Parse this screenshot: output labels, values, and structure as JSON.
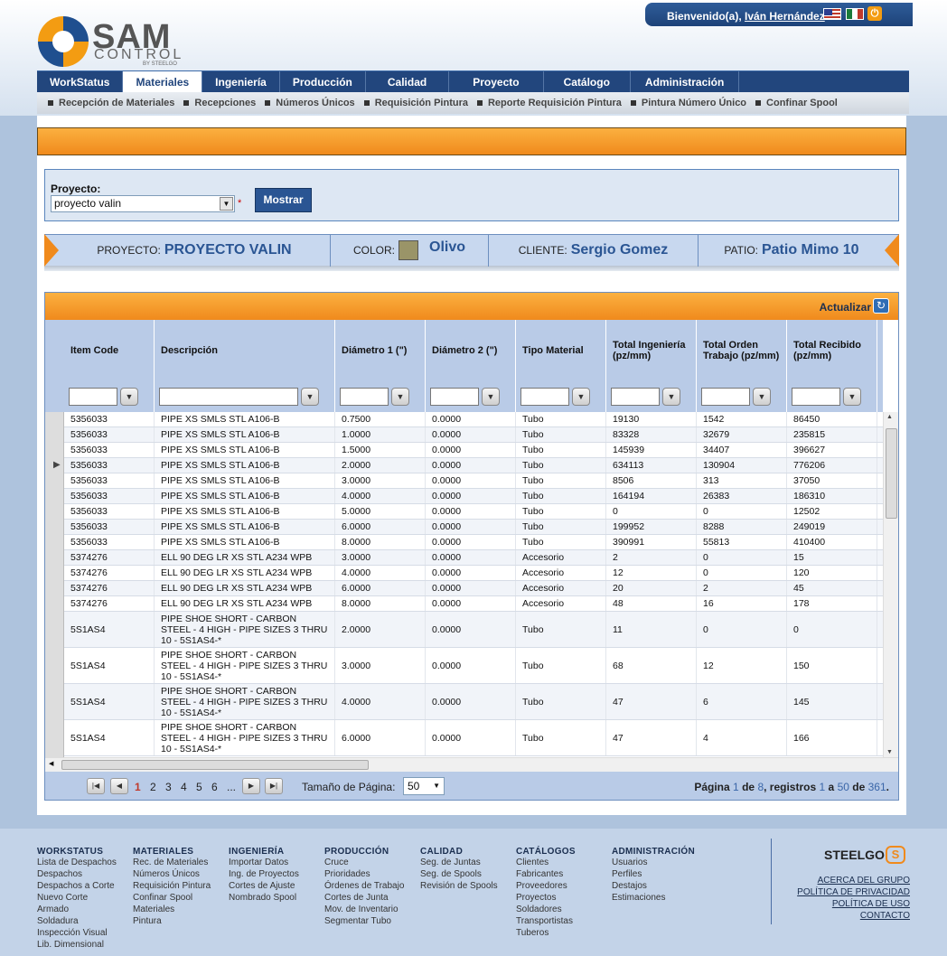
{
  "header": {
    "welcome_prefix": "Bienvenido(a),",
    "user_name": "Iván Hernández",
    "logo_main": "SAM",
    "logo_sub": "CONTROL",
    "logo_by": "BY STEELGO"
  },
  "main_nav": [
    "WorkStatus",
    "Materiales",
    "Ingeniería",
    "Producción",
    "Calidad",
    "Proyecto",
    "Catálogo",
    "Administración"
  ],
  "sub_nav": [
    "Recepción de Materiales",
    "Recepciones",
    "Números Únicos",
    "Requisición Pintura",
    "Reporte Requisición Pintura",
    "Pintura Número Único",
    "Confinar Spool"
  ],
  "filter": {
    "label": "Proyecto:",
    "project_value": "proyecto valin",
    "required_mark": "*",
    "show_button": "Mostrar"
  },
  "project_info": {
    "project_label": "PROYECTO:",
    "project_value": "PROYECTO VALIN",
    "color_label": "COLOR:",
    "color_value": "Olivo",
    "color_swatch": "#9a9468",
    "client_label": "CLIENTE:",
    "client_value": "Sergio Gomez",
    "yard_label": "PATIO:",
    "yard_value": "Patio Mimo 10"
  },
  "grid": {
    "refresh_label": "Actualizar",
    "columns": [
      "Item Code",
      "Descripción",
      "Diámetro 1 (\")",
      "Diámetro 2 (\")",
      "Tipo Material",
      "Total Ingeniería (pz/mm)",
      "Total Orden Trabajo (pz/mm)",
      "Total Recibido (pz/mm)"
    ],
    "rows": [
      [
        "5356033",
        "PIPE XS SMLS STL A106-B",
        "0.7500",
        "0.0000",
        "Tubo",
        "19130",
        "1542",
        "86450"
      ],
      [
        "5356033",
        "PIPE XS SMLS STL A106-B",
        "1.0000",
        "0.0000",
        "Tubo",
        "83328",
        "32679",
        "235815"
      ],
      [
        "5356033",
        "PIPE XS SMLS STL A106-B",
        "1.5000",
        "0.0000",
        "Tubo",
        "145939",
        "34407",
        "396627"
      ],
      [
        "5356033",
        "PIPE XS SMLS STL A106-B",
        "2.0000",
        "0.0000",
        "Tubo",
        "634113",
        "130904",
        "776206"
      ],
      [
        "5356033",
        "PIPE XS SMLS STL A106-B",
        "3.0000",
        "0.0000",
        "Tubo",
        "8506",
        "313",
        "37050"
      ],
      [
        "5356033",
        "PIPE XS SMLS STL A106-B",
        "4.0000",
        "0.0000",
        "Tubo",
        "164194",
        "26383",
        "186310"
      ],
      [
        "5356033",
        "PIPE XS SMLS STL A106-B",
        "5.0000",
        "0.0000",
        "Tubo",
        "0",
        "0",
        "12502"
      ],
      [
        "5356033",
        "PIPE XS SMLS STL A106-B",
        "6.0000",
        "0.0000",
        "Tubo",
        "199952",
        "8288",
        "249019"
      ],
      [
        "5356033",
        "PIPE XS SMLS STL A106-B",
        "8.0000",
        "0.0000",
        "Tubo",
        "390991",
        "55813",
        "410400"
      ],
      [
        "5374276",
        "ELL 90 DEG LR XS STL A234 WPB",
        "3.0000",
        "0.0000",
        "Accesorio",
        "2",
        "0",
        "15"
      ],
      [
        "5374276",
        "ELL 90 DEG LR XS STL A234 WPB",
        "4.0000",
        "0.0000",
        "Accesorio",
        "12",
        "0",
        "120"
      ],
      [
        "5374276",
        "ELL 90 DEG LR XS STL A234 WPB",
        "6.0000",
        "0.0000",
        "Accesorio",
        "20",
        "2",
        "45"
      ],
      [
        "5374276",
        "ELL 90 DEG LR XS STL A234 WPB",
        "8.0000",
        "0.0000",
        "Accesorio",
        "48",
        "16",
        "178"
      ],
      [
        "5S1AS4",
        "PIPE SHOE SHORT - CARBON STEEL - 4 HIGH - PIPE SIZES 3 THRU 10 - 5S1AS4-*",
        "2.0000",
        "0.0000",
        "Tubo",
        "11",
        "0",
        "0"
      ],
      [
        "5S1AS4",
        "PIPE SHOE SHORT - CARBON STEEL - 4 HIGH - PIPE SIZES 3 THRU 10 - 5S1AS4-*",
        "3.0000",
        "0.0000",
        "Tubo",
        "68",
        "12",
        "150"
      ],
      [
        "5S1AS4",
        "PIPE SHOE SHORT - CARBON STEEL - 4 HIGH - PIPE SIZES 3 THRU 10 - 5S1AS4-*",
        "4.0000",
        "0.0000",
        "Tubo",
        "47",
        "6",
        "145"
      ],
      [
        "5S1AS4",
        "PIPE SHOE SHORT - CARBON STEEL - 4 HIGH - PIPE SIZES 3 THRU 10 - 5S1AS4-*",
        "6.0000",
        "0.0000",
        "Tubo",
        "47",
        "4",
        "166"
      ]
    ]
  },
  "pager": {
    "pages": [
      "1",
      "2",
      "3",
      "4",
      "5",
      "6",
      "..."
    ],
    "current_page": "1",
    "page_size_label": "Tamaño de Página:",
    "page_size": "50",
    "info_pagina": "Página",
    "info_page": "1",
    "info_de": "de",
    "info_total_pages": "8",
    "info_registros": ", registros",
    "info_from": "1",
    "info_a": "a",
    "info_to": "50",
    "info_de2": "de",
    "info_total": "361",
    "info_end": "."
  },
  "footer": {
    "columns": [
      {
        "title": "WORKSTATUS",
        "links": [
          "Lista de Despachos",
          "Despachos",
          "Despachos a Corte",
          "Nuevo Corte",
          "Armado",
          "Soldadura",
          "Inspección Visual",
          "Lib. Dimensional"
        ]
      },
      {
        "title": "MATERIALES",
        "links": [
          "Rec. de Materiales",
          "Números Únicos",
          "Requisición Pintura",
          "Confinar Spool",
          "Materiales",
          "Pintura"
        ]
      },
      {
        "title": "INGENIERÍA",
        "links": [
          "Importar Datos",
          "Ing. de Proyectos",
          "Cortes de Ajuste",
          "Nombrado Spool"
        ]
      },
      {
        "title": "PRODUCCIÓN",
        "links": [
          "Cruce",
          "Prioridades",
          "Órdenes de Trabajo",
          "Cortes de Junta",
          "Mov. de Inventario",
          "Segmentar Tubo"
        ]
      },
      {
        "title": "CALIDAD",
        "links": [
          "Seg. de Juntas",
          "Seg. de Spools",
          "Revisión de Spools"
        ]
      },
      {
        "title": "CATÁLOGOS",
        "links": [
          "Clientes",
          "Fabricantes",
          "Proveedores",
          "Proyectos",
          "Soldadores",
          "Transportistas",
          "Tuberos"
        ]
      },
      {
        "title": "ADMINISTRACIÓN",
        "links": [
          "Usuarios",
          "Perfiles",
          "Destajos",
          "Estimaciones"
        ]
      }
    ],
    "brand": "STEELGO",
    "brand_mark": "S",
    "links": [
      "ACERCA DEL GRUPO",
      "POLÍTICA DE PRIVACIDAD",
      "POLÍTICA DE USO",
      "CONTACTO"
    ]
  }
}
